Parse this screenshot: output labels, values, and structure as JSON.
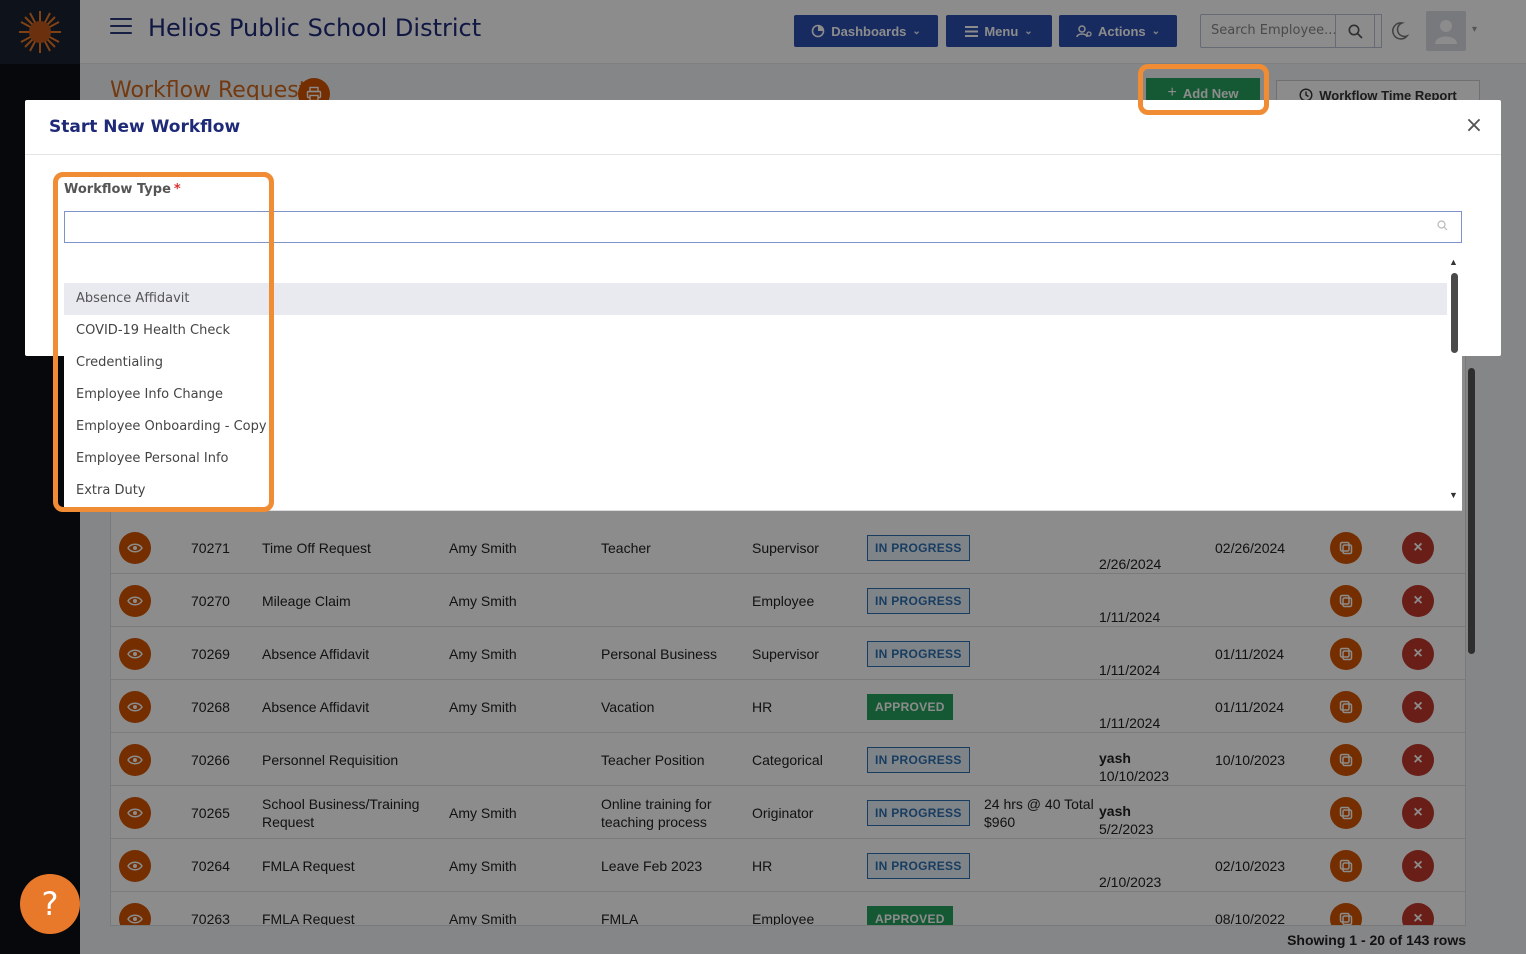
{
  "app": {
    "title": "Helios Public School District"
  },
  "header": {
    "dashboards_label": "Dashboards",
    "menu_label": "Menu",
    "actions_label": "Actions",
    "search_placeholder": "Search Employee..."
  },
  "page": {
    "title": "Workflow Requests",
    "add_new_label": "Add New",
    "time_report_label": "Workflow Time Report"
  },
  "table": {
    "rows": [
      {
        "id": "70271",
        "type": "Time Off Request",
        "employee": "Amy Smith",
        "detail": "Teacher",
        "step": "Supervisor",
        "status": "IN PROGRESS",
        "extra": "",
        "by": "",
        "created": "2/26/2024",
        "date": "02/26/2024"
      },
      {
        "id": "70270",
        "type": "Mileage Claim",
        "employee": "Amy Smith",
        "detail": "",
        "step": "Employee",
        "status": "IN PROGRESS",
        "extra": "",
        "by": "",
        "created": "1/11/2024",
        "date": ""
      },
      {
        "id": "70269",
        "type": "Absence Affidavit",
        "employee": "Amy Smith",
        "detail": "Personal Business",
        "step": "Supervisor",
        "status": "IN PROGRESS",
        "extra": "",
        "by": "",
        "created": "1/11/2024",
        "date": "01/11/2024"
      },
      {
        "id": "70268",
        "type": "Absence Affidavit",
        "employee": "Amy Smith",
        "detail": "Vacation",
        "step": "HR",
        "status": "APPROVED",
        "extra": "",
        "by": "",
        "created": "1/11/2024",
        "date": "01/11/2024"
      },
      {
        "id": "70266",
        "type": "Personnel Requisition",
        "employee": "",
        "detail": "Teacher Position",
        "step": "Categorical",
        "status": "IN PROGRESS",
        "extra": "",
        "by": "yash",
        "created": "10/10/2023",
        "date": "10/10/2023"
      },
      {
        "id": "70265",
        "type": "School Business/Training Request",
        "employee": "Amy Smith",
        "detail": "Online training for teaching process",
        "step": "Originator",
        "status": "IN PROGRESS",
        "extra": "24 hrs @ 40 Total $960",
        "by": "yash",
        "created": "5/2/2023",
        "date": ""
      },
      {
        "id": "70264",
        "type": "FMLA Request",
        "employee": "Amy Smith",
        "detail": "Leave Feb 2023",
        "step": "HR",
        "status": "IN PROGRESS",
        "extra": "",
        "by": "",
        "created": "2/10/2023",
        "date": "02/10/2023"
      },
      {
        "id": "70263",
        "type": "FMLA Request",
        "employee": "Amy Smith",
        "detail": "FMLA",
        "step": "Employee",
        "status": "APPROVED",
        "extra": "",
        "by": "",
        "created": "",
        "date": "08/10/2022"
      }
    ],
    "footer": "Showing 1 - 20 of 143 rows"
  },
  "modal": {
    "title": "Start New Workflow",
    "field_label": "Workflow Type",
    "required_mark": "*",
    "input_value": "",
    "options": [
      "Absence Affidavit",
      "COVID-19 Health Check",
      "Credentialing",
      "Employee Info Change",
      "Employee Onboarding - Copy",
      "Employee Personal Info",
      "Extra Duty"
    ],
    "highlighted_option": "Absence Affidavit"
  },
  "help": {
    "label": "?"
  },
  "colors": {
    "brand_blue": "#2d4fb0",
    "accent_orange": "#d35400",
    "highlight_orange": "#f08c33",
    "success_green": "#27a35f"
  }
}
